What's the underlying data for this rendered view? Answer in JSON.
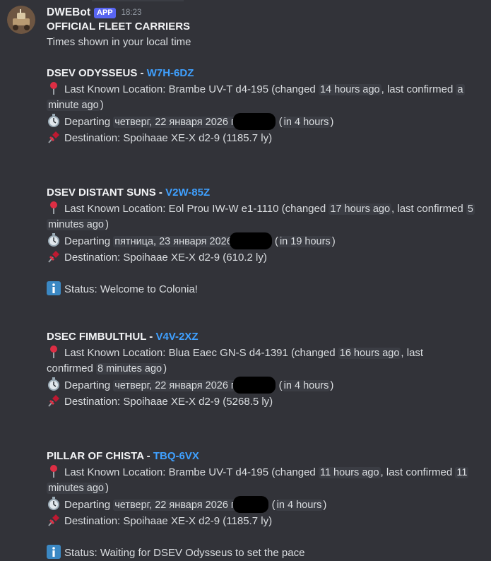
{
  "bot": {
    "name": "DWEBot",
    "badge": "APP",
    "time": "18:23"
  },
  "message": {
    "heading": "OFFICIAL FLEET CARRIERS",
    "subheading": "Times shown in your local time"
  },
  "carriers": [
    {
      "name": "DSEV ODYSSEUS",
      "sep": " - ",
      "callsign": "W7H-6DZ",
      "location_prefix": "Last Known Location: Brambe UV-T d4-195 (changed ",
      "changed": "14 hours ago",
      "confirmed_prefix": ", last confirmed ",
      "confirmed_1": "a",
      "confirmed_2": "minute ago",
      "close": ")",
      "departing_label": "Departing",
      "departing_date": "четверг, 22 января 2026 г.",
      "departing_open": " (",
      "departing_rel": "in 4 hours",
      "departing_close": ")",
      "destination": "Destination: Spoihaae XE-X d2-9 (1185.7 ly)"
    },
    {
      "name": "DSEV DISTANT SUNS",
      "sep": " - ",
      "callsign": "V2W-85Z",
      "location_prefix": "Last Known Location: Eol Prou IW-W e1-1110 (changed ",
      "changed": "17 hours ago",
      "confirmed_prefix": ", last confirmed ",
      "confirmed_1": "5",
      "confirmed_2": "minutes ago",
      "close": ")",
      "departing_label": "Departing",
      "departing_date": "пятница, 23 января 2026",
      "departing_open": " (",
      "departing_rel": "in 19 hours",
      "departing_close": ")",
      "destination": "Destination: Spoihaae XE-X d2-9 (610.2 ly)",
      "status": "Status: Welcome to Colonia!"
    },
    {
      "name": "DSEC FIMBULTHUL",
      "sep": " - ",
      "callsign": "V4V-2XZ",
      "location_prefix": "Last Known Location: Blua Eaec GN-S d4-1391 (changed ",
      "changed": "16 hours ago",
      "confirmed_prefix": ", last",
      "confirmed_prefix_2": "confirmed ",
      "confirmed_2": "8 minutes ago",
      "close": ")",
      "departing_label": "Departing",
      "departing_date": "четверг, 22 января 2026 г.",
      "departing_open": " (",
      "departing_rel": "in 4 hours",
      "departing_close": ")",
      "destination": "Destination: Spoihaae XE-X d2-9 (5268.5 ly)"
    },
    {
      "name": "PILLAR OF CHISTA",
      "sep": " - ",
      "callsign": "TBQ-6VX",
      "location_prefix": "Last Known Location: Brambe UV-T d4-195 (changed ",
      "changed": "11 hours ago",
      "confirmed_prefix": ", last confirmed ",
      "confirmed_1": "11",
      "confirmed_2": "minutes ago",
      "close": ")",
      "departing_label": "Departing",
      "departing_date": "четверг, 22 января 2026 г.",
      "departing_open": " (",
      "departing_rel": "in 4 hours",
      "departing_close": ")",
      "destination": "Destination: Spoihaae XE-X d2-9 (1185.7 ly)",
      "status": "Status: Waiting for DSEV Odysseus to set the pace"
    }
  ],
  "icons": {
    "location": "round-pushpin-icon",
    "departing": "stopwatch-icon",
    "destination": "pushpin-icon",
    "status": "information-icon"
  },
  "colors": {
    "background": "#323339",
    "callsign": "#3fa0ff",
    "badge": "#5865f2",
    "code_bg": "#3b3d44"
  }
}
